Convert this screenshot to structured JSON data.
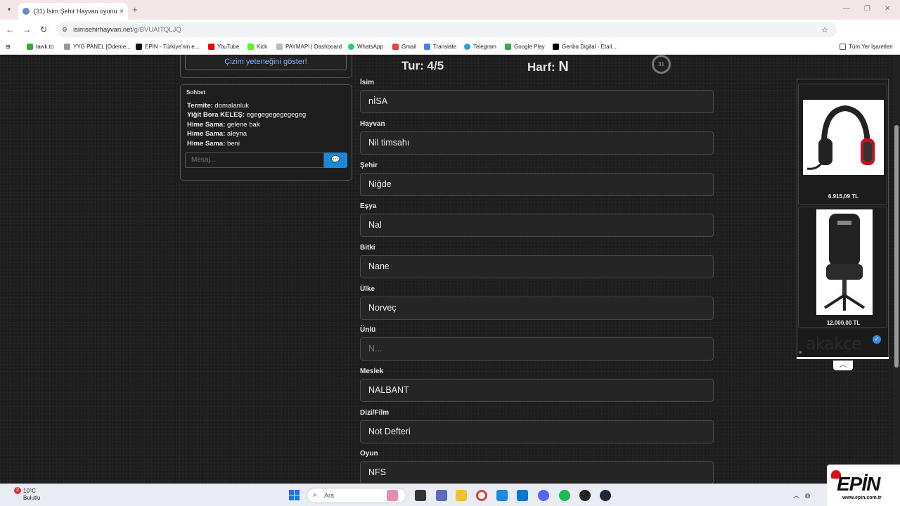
{
  "browser": {
    "tab_title": "(31) İsim Şehir Hayvan oyunun",
    "tab_close": "×",
    "new_tab": "+",
    "url_domain": "isimsehirhayvan.net",
    "url_path": "/g/BVUAITQLJQ",
    "bookmarks": [
      "tawk.to",
      "YYG PANEL [Ödeme...",
      "EPİN - Türkiye'nin e...",
      "YouTube",
      "Kick",
      "PAYMAPI | Dashboard",
      "WhatsApp",
      "Gmail",
      "Translate",
      "Telegram",
      "Google Play",
      "Genba Digital - Etail..."
    ],
    "bookmarks_folder": "Tüm Yer İşaretleri"
  },
  "left": {
    "draw_button": "Çizim yeteneğini göster!",
    "chat": {
      "title": "Sohbet",
      "messages": [
        {
          "user": "Termite:",
          "text": "domalanluk"
        },
        {
          "user": "Yiğit Bora KELEŞ:",
          "text": "egegegegegegegeg"
        },
        {
          "user": "Hime Sama:",
          "text": "gelene bak"
        },
        {
          "user": "Hime Sama:",
          "text": "aleyna"
        },
        {
          "user": "Hime Sama:",
          "text": "beni"
        }
      ],
      "input_placeholder": "Mesaj..."
    }
  },
  "game": {
    "round_label": "Tur:",
    "round_value": "4/5",
    "letter_label": "Harf:",
    "letter_value": "N",
    "timer": "31",
    "fields": [
      {
        "label": "İsim",
        "value": "nİSA",
        "placeholder": false
      },
      {
        "label": "Hayvan",
        "value": "Nil timsahı",
        "placeholder": false
      },
      {
        "label": "Şehir",
        "value": "Niğde",
        "placeholder": false
      },
      {
        "label": "Eşya",
        "value": "Nal",
        "placeholder": false
      },
      {
        "label": "Bitki",
        "value": "Nane",
        "placeholder": false
      },
      {
        "label": "Ülke",
        "value": "Norveç",
        "placeholder": false
      },
      {
        "label": "Ünlü",
        "value": "N...",
        "placeholder": true
      },
      {
        "label": "Meslek",
        "value": "NALBANT",
        "placeholder": false
      },
      {
        "label": "Dizi/Film",
        "value": "Not Defteri",
        "placeholder": false
      },
      {
        "label": "Oyun",
        "value": "NFS",
        "placeholder": false
      }
    ]
  },
  "ad": {
    "products": [
      {
        "price": "6.915,09 TL",
        "icon": "headset-image"
      },
      {
        "price": "12.000,00 TL",
        "icon": "gaming-chair-image"
      }
    ],
    "brand": "akakçe"
  },
  "taskbar": {
    "weather_badge": "2",
    "temperature": "10°C",
    "condition": "Bulutlu",
    "search_placeholder": "Ara"
  },
  "overlay": {
    "logo": "EPİN",
    "site": "www.epin.com.tr"
  },
  "colors": {
    "accent": "#1a8ad6",
    "link": "#7fb0ff",
    "background": "#1d1d1d"
  }
}
